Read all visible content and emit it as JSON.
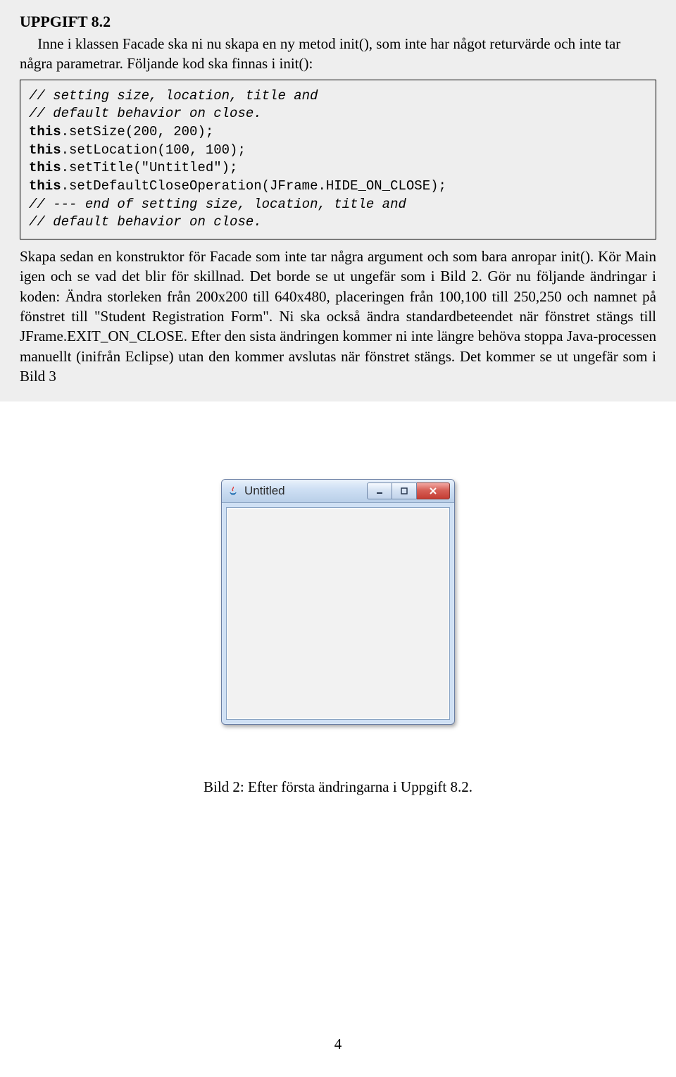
{
  "heading": "UPPGIFT 8.2",
  "intro": "Inne i klassen Facade ska ni nu skapa en ny metod init(), som inte har något returvärde och inte tar några parametrar. Följande kod ska finnas i init():",
  "code": {
    "c1": "// setting size, location, title and",
    "c2": "// default behavior on close.",
    "kw": "this",
    "l1": ".setSize(200, 200);",
    "l2": ".setLocation(100, 100);",
    "l3": ".setTitle(\"Untitled\");",
    "l4": ".setDefaultCloseOperation(JFrame.HIDE_ON_CLOSE);",
    "c3": "// --- end of setting size, location, title and",
    "c4": "// default behavior on close."
  },
  "after": "Skapa sedan en konstruktor för Facade som inte tar några argument och som bara anropar init(). Kör Main igen och se vad det blir för skillnad. Det borde se ut ungefär som i Bild 2.\nGör nu följande ändringar i koden: Ändra storleken från 200x200 till 640x480, placeringen från 100,100 till 250,250 och namnet på fönstret till \"Student Registration Form\". Ni ska också ändra standardbeteendet när fönstret stängs till JFrame.EXIT_ON_CLOSE. Efter den sista ändringen kommer ni inte längre behöva stoppa Java-processen manuellt (inifrån Eclipse) utan den kommer avslutas när fönstret stängs. Det kommer se ut ungefär som i Bild 3",
  "window": {
    "title": "Untitled"
  },
  "caption": "Bild 2: Efter första ändringarna i Uppgift 8.2.",
  "page": "4"
}
